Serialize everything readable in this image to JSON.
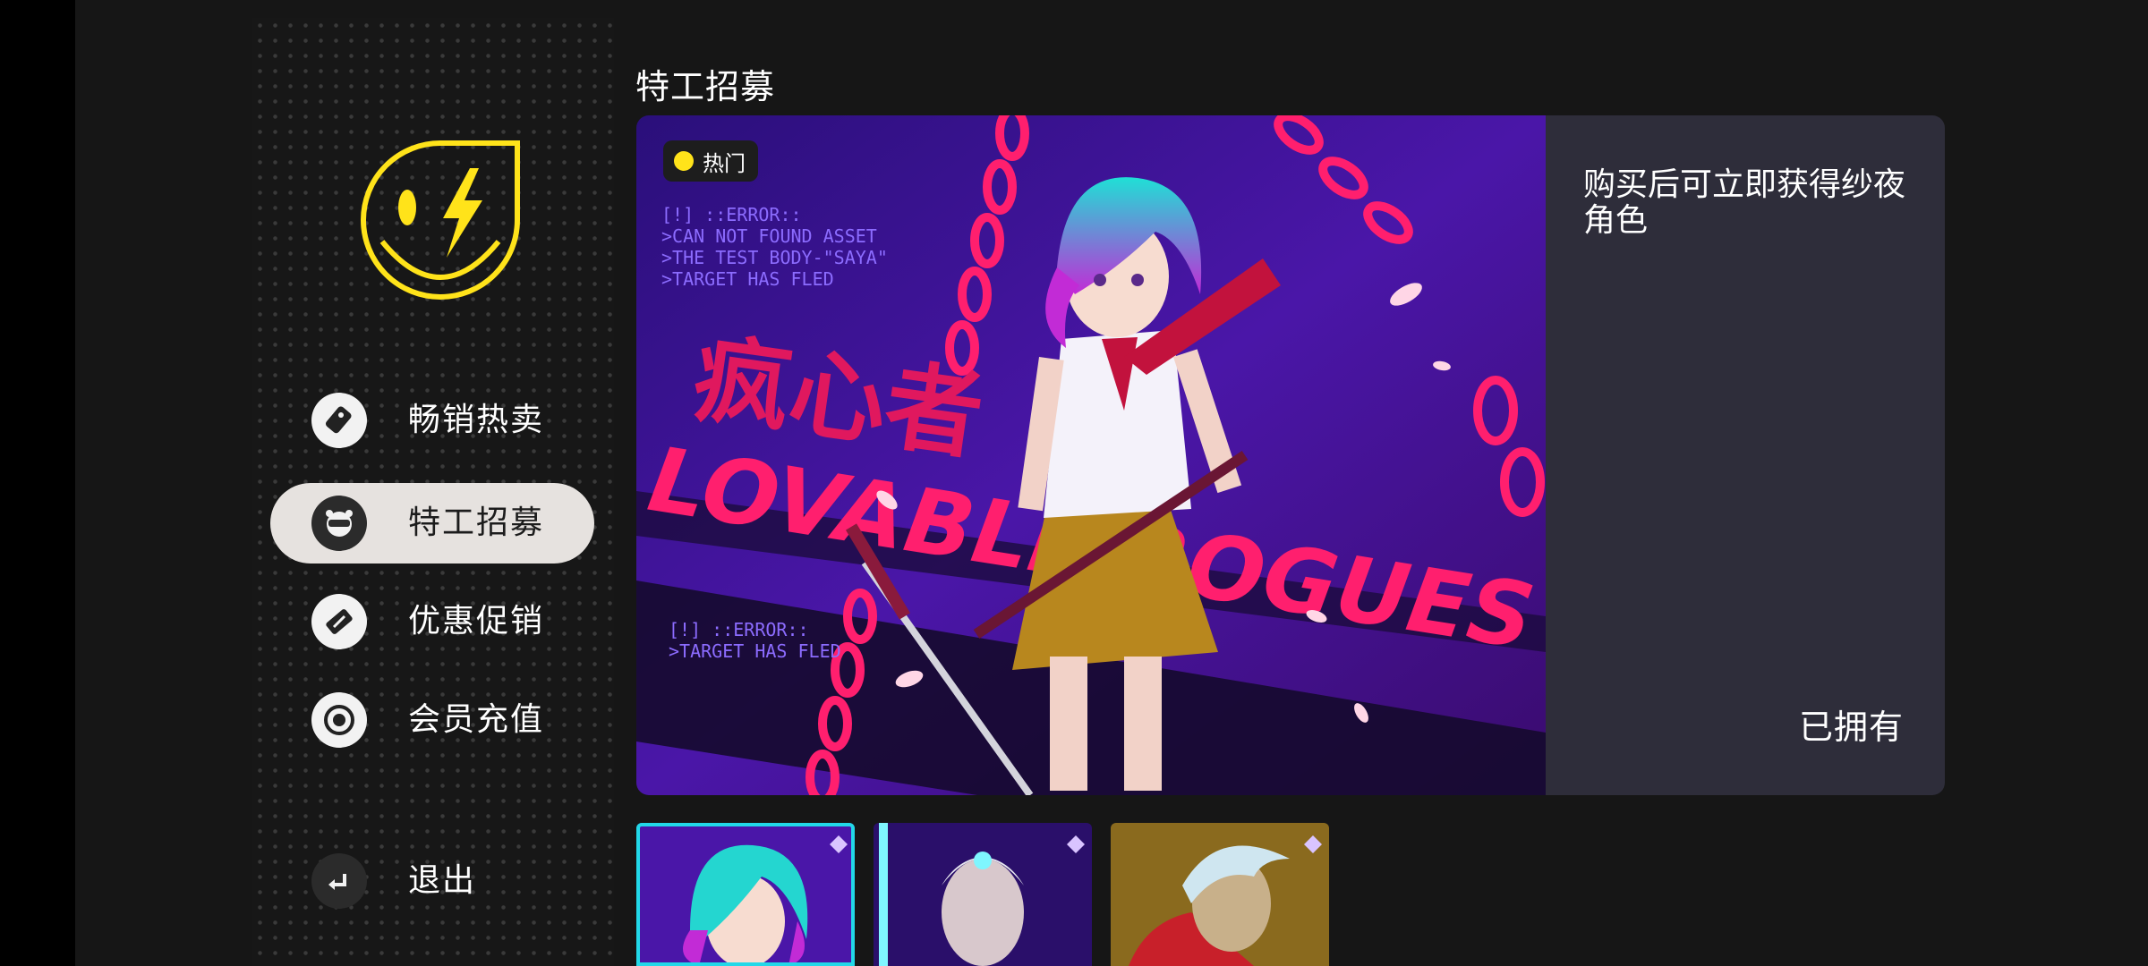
{
  "sidebar": {
    "items": [
      {
        "label": "畅销热卖",
        "icon": "tag-icon"
      },
      {
        "label": "特工招募",
        "icon": "agent-mask-icon"
      },
      {
        "label": "优惠促销",
        "icon": "ticket-icon"
      },
      {
        "label": "会员充值",
        "icon": "coin-icon"
      }
    ],
    "exit_label": "退出",
    "active_index": 1
  },
  "main": {
    "section_title": "特工招募",
    "banner": {
      "badge": "热门",
      "art_texts": {
        "error_block_1": [
          "[!] ::ERROR::",
          ">CAN NOT FOUND ASSET",
          ">THE TEST BODY-\"SAYA\"",
          ">TARGET HAS FLED"
        ],
        "error_block_2": [
          "[!] ::ERROR::",
          ">TARGET HAS FLED"
        ],
        "chinese_title": "疯心者",
        "english_title": "LOVABLE ROGUES"
      },
      "description": "购买后可立即获得纱夜角色",
      "status": "已拥有"
    },
    "thumbnails": [
      {
        "name": "saya",
        "selected": true
      },
      {
        "name": "cyber-agent",
        "selected": false
      },
      {
        "name": "silver-hair-agent",
        "selected": false
      }
    ]
  },
  "colors": {
    "accent_yellow": "#ffe31a",
    "selection_cyan": "#22d8e8",
    "active_nav_bg": "#e6e2df",
    "panel_bg": "#2e2d3a",
    "art_magenta": "#ff1f6e",
    "art_purple": "#4a16a8"
  }
}
